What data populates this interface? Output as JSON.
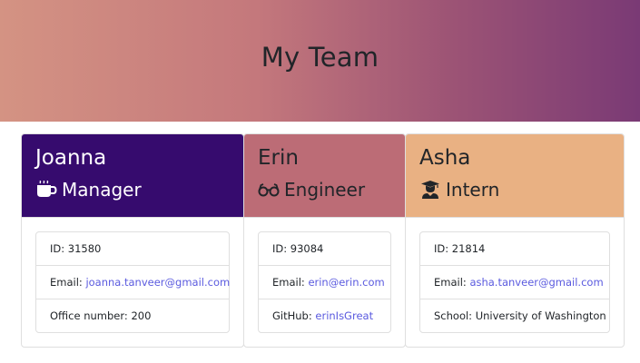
{
  "header": {
    "title": "My Team"
  },
  "colors": {
    "manager": "#360b6e",
    "engineer": "#bc6c76",
    "intern": "#e9b183",
    "link": "#5a5adf"
  },
  "cards": [
    {
      "name": "Joanna",
      "role": "Manager",
      "role_icon": "coffee-mug-icon",
      "id_label": "ID: ",
      "id": "31580",
      "email_label": "Email: ",
      "email": "joanna.tanveer@gmail.com",
      "extra_label": "Office number: ",
      "extra_value": "200"
    },
    {
      "name": "Erin",
      "role": "Engineer",
      "role_icon": "glasses-icon",
      "id_label": "ID: ",
      "id": "93084",
      "email_label": "Email: ",
      "email": "erin@erin.com",
      "extra_label": "GitHub: ",
      "extra_value": "erinIsGreat"
    },
    {
      "name": "Asha",
      "role": "Intern",
      "role_icon": "graduate-icon",
      "id_label": "ID: ",
      "id": "21814",
      "email_label": "Email: ",
      "email": "asha.tanveer@gmail.com",
      "extra_label": "School: ",
      "extra_value": "University of Washington"
    }
  ]
}
